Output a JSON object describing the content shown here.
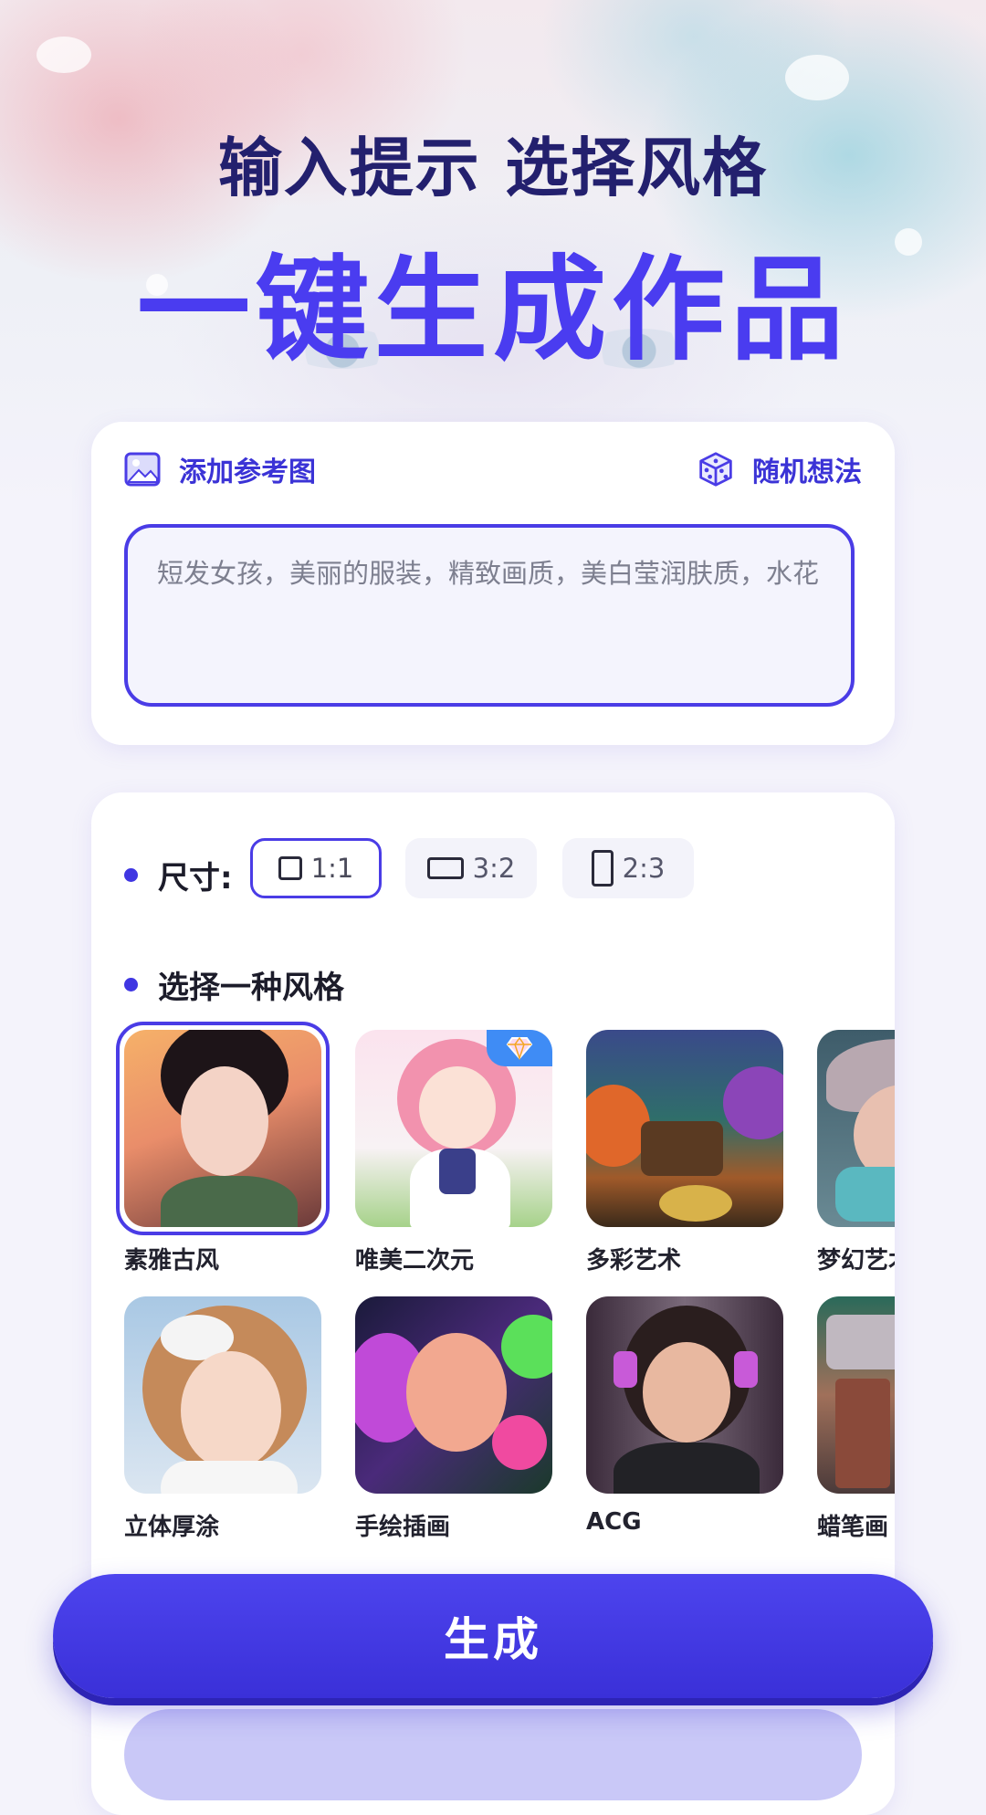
{
  "hero": {
    "line1": "输入提示  选择风格",
    "line2": "一键生成作品"
  },
  "prompt_card": {
    "add_reference_label": "添加参考图",
    "add_reference_icon": "image-icon",
    "random_idea_label": "随机想法",
    "random_idea_icon": "dice-icon",
    "prompt_text": "短发女孩，美丽的服装，精致画质，美白莹润肤质，水花"
  },
  "options": {
    "size_label": "尺寸:",
    "sizes": [
      {
        "label": "1:1",
        "selected": true
      },
      {
        "label": "3:2",
        "selected": false
      },
      {
        "label": "2:3",
        "selected": false
      }
    ],
    "style_label": "选择一种风格",
    "styles": [
      {
        "name": "素雅古风",
        "selected": true
      },
      {
        "name": "唯美二次元",
        "vip": true
      },
      {
        "name": "多彩艺术"
      },
      {
        "name": "梦幻艺术"
      },
      {
        "name": "立体厚涂"
      },
      {
        "name": "手绘插画"
      },
      {
        "name": "ACG"
      },
      {
        "name": "蜡笔画"
      }
    ]
  },
  "generate_button": {
    "label": "生成"
  },
  "colors": {
    "accent": "#4a3ce6",
    "title_dark": "#23206e",
    "title_accent": "#4a3cf0"
  }
}
